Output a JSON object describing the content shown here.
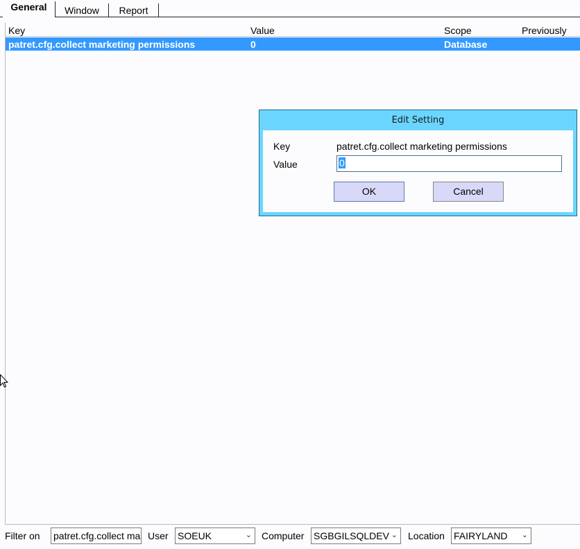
{
  "tabs": [
    {
      "label": "General",
      "active": true
    },
    {
      "label": "Window",
      "active": false
    },
    {
      "label": "Report",
      "active": false
    }
  ],
  "list": {
    "columns": [
      "Key",
      "Value",
      "Scope",
      "Previously"
    ],
    "rows": [
      {
        "key": "patret.cfg.collect marketing permissions",
        "value": "0",
        "scope": "Database",
        "previously": ""
      }
    ]
  },
  "dialog": {
    "title": "Edit Setting",
    "key_label": "Key",
    "key_value": "patret.cfg.collect marketing permissions",
    "value_label": "Value",
    "value_input": "0",
    "ok_label": "OK",
    "cancel_label": "Cancel"
  },
  "footer": {
    "filter_label": "Filter on",
    "filter_value": "patret.cfg.collect ma",
    "user_label": "User",
    "user_value": "SOEUK",
    "computer_label": "Computer",
    "computer_value": "SGBGILSQLDEV",
    "location_label": "Location",
    "location_value": "FAIRYLAND"
  },
  "icons": {
    "dropdown": "chevron-down-icon",
    "pointer": "mouse-cursor-icon"
  },
  "colors": {
    "selection": "#3399ff",
    "dialog_frame": "#6ad6ff",
    "button": "#d8d8f8"
  }
}
